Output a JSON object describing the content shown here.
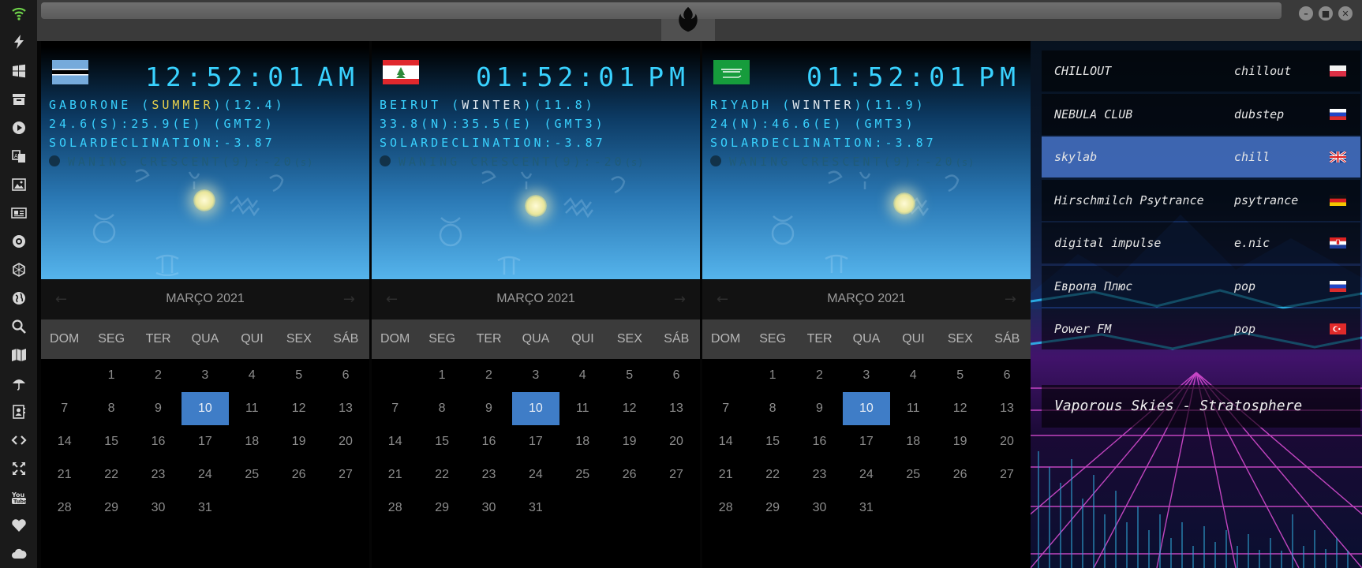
{
  "sidebar": {
    "icons": [
      "wifi-icon",
      "lightning-icon",
      "windows-icon",
      "archive-icon",
      "play-icon",
      "translate-icon",
      "image-icon",
      "news-icon",
      "rebel-icon",
      "hexagon-icon",
      "globe-icon",
      "search-icon",
      "map-icon",
      "umbrella-icon",
      "contacts-icon",
      "code-icon",
      "expand-icon",
      "youtube-icon",
      "heart-icon",
      "cloud-icon"
    ]
  },
  "clocks": [
    {
      "flag": "botswana-flag",
      "time": "12:52:01",
      "ampm": "AM",
      "city_prefix": "GABORONE (",
      "season": "SUMMER",
      "city_suffix": ")(12.4)",
      "coords": "24.6(S):25.9(E) (GMT2)",
      "solar": "SOLARDECLINATION:-3.87",
      "moon": "WANING CRESCENT(9):-20",
      "moon_unit": "(s)"
    },
    {
      "flag": "lebanon-flag",
      "time": "01:52:01",
      "ampm": "PM",
      "city_prefix": "BEIRUT (",
      "season": "WINTER",
      "city_suffix": ")(11.8)",
      "coords": "33.8(N):35.5(E) (GMT3)",
      "solar": "SOLARDECLINATION:-3.87",
      "moon": "WANING CRESCENT(9):-20",
      "moon_unit": "(s)"
    },
    {
      "flag": "saudi-arabia-flag",
      "time": "01:52:01",
      "ampm": "PM",
      "city_prefix": "RIYADH (",
      "season": "WINTER",
      "city_suffix": ")(11.9)",
      "coords": "24(N):46.6(E) (GMT3)",
      "solar": "SOLARDECLINATION:-3.87",
      "moon": "WANING CRESCENT(9):-20",
      "moon_unit": "(s)"
    }
  ],
  "calendar": {
    "title": "MARÇO 2021",
    "prev": "←",
    "next": "→",
    "weekdays": [
      "DOM",
      "SEG",
      "TER",
      "QUA",
      "QUI",
      "SEX",
      "SÁB"
    ],
    "first_offset": 1,
    "days_in_month": 31,
    "today": 10
  },
  "radio": {
    "stations": [
      {
        "name": "CHILLOUT",
        "genre": "chillout",
        "flag": "poland-flag"
      },
      {
        "name": "NEBULA CLUB",
        "genre": "dubstep",
        "flag": "russia-flag"
      },
      {
        "name": "skylab",
        "genre": "chill",
        "flag": "uk-flag",
        "active": true
      },
      {
        "name": "Hirschmilch Psytrance",
        "genre": "psytrance",
        "flag": "germany-flag"
      },
      {
        "name": "digital impulse",
        "genre": "e.nic",
        "flag": "croatia-flag"
      },
      {
        "name": "Европа Плюс",
        "genre": "pop",
        "flag": "russia-flag"
      },
      {
        "name": "Power FM",
        "genre": "pop",
        "flag": "turkey-flag"
      }
    ],
    "now_playing": "Vaporous Skies - Stratosphere"
  },
  "colors": {
    "clock_cyan": "#39d2ff",
    "season_yellow": "#e7d04c",
    "calendar_today": "#3f7dc7",
    "station_active": "#4673c8"
  }
}
